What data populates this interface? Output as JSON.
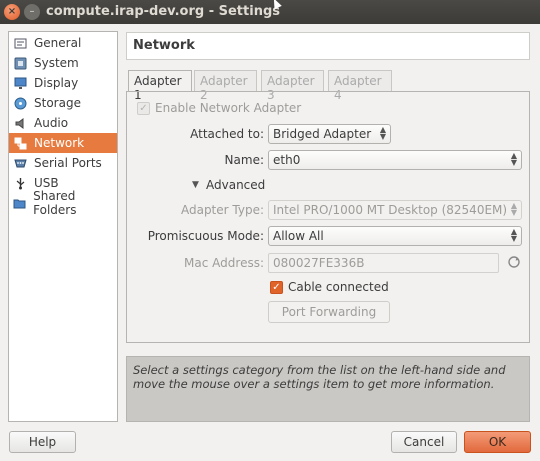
{
  "window": {
    "title": "compute.irap-dev.org - Settings",
    "close_glyph": "×",
    "minimize_glyph": "–"
  },
  "sidebar": {
    "items": [
      {
        "label": "General",
        "icon": "general-icon"
      },
      {
        "label": "System",
        "icon": "system-icon"
      },
      {
        "label": "Display",
        "icon": "display-icon"
      },
      {
        "label": "Storage",
        "icon": "storage-icon"
      },
      {
        "label": "Audio",
        "icon": "audio-icon"
      },
      {
        "label": "Network",
        "icon": "network-icon",
        "active": true
      },
      {
        "label": "Serial Ports",
        "icon": "serial-ports-icon"
      },
      {
        "label": "USB",
        "icon": "usb-icon"
      },
      {
        "label": "Shared Folders",
        "icon": "shared-folders-icon"
      }
    ]
  },
  "header": {
    "title": "Network"
  },
  "tabs": [
    "Adapter 1",
    "Adapter 2",
    "Adapter 3",
    "Adapter 4"
  ],
  "adapter": {
    "enable_label": "Enable Network Adapter",
    "attached_label": "Attached to:",
    "attached_value": "Bridged Adapter",
    "name_label": "Name:",
    "name_value": "eth0",
    "advanced_label": "Advanced",
    "adapter_type_label": "Adapter Type:",
    "adapter_type_value": "Intel PRO/1000 MT Desktop (82540EM)",
    "promiscuous_label": "Promiscuous Mode:",
    "promiscuous_value": "Allow All",
    "mac_label": "Mac Address:",
    "mac_value": "080027FE336B",
    "cable_label": "Cable connected",
    "port_forwarding_label": "Port Forwarding"
  },
  "info_text": "Select a settings category from the list on the left-hand side and move the mouse over a settings item to get more information.",
  "footer": {
    "help_label": "Help",
    "cancel_label": "Cancel",
    "ok_label": "OK"
  },
  "colors": {
    "accent": "#e77a3f",
    "titlebar": "#3c3b37",
    "info_bg": "#cac8c4"
  }
}
